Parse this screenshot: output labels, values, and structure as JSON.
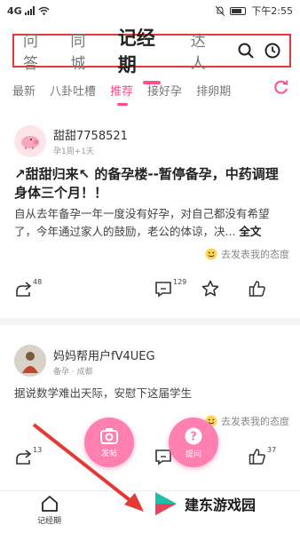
{
  "status": {
    "carrier": "4G",
    "time": "下午2:55"
  },
  "top_tabs": [
    "问答",
    "同城",
    "记经期",
    "达人"
  ],
  "sub_tabs": [
    "最新",
    "八卦吐槽",
    "推荐",
    "接好孕",
    "排卵期"
  ],
  "posts": [
    {
      "user": "甜甜7758521",
      "meta": "孕1周+1天",
      "title_line1": "↗甜甜归来↖ 的备孕楼--暂停备孕，中药调理",
      "title_line2": "身体三个月！！",
      "body_line1": "自从去年备孕一年一度没有好孕，对自己都没有希望",
      "body_line2": "了，今年通过家人的鼓励，老公的体谅，决...",
      "more": "全文",
      "attitude": "去发表我的态度",
      "shares": "48",
      "comments": "129"
    },
    {
      "user": "妈妈帮用户fV4UEG",
      "meta": "备孕 · 成都",
      "body_line1": "据说数学难出天际，安慰下这届学生",
      "attitude": "去发表我的态度",
      "shares": "13",
      "likes": "37"
    }
  ],
  "fab": {
    "post_label": "发帖",
    "ask_label": "提问"
  },
  "bottom": {
    "period_label": "记经期"
  },
  "watermark": "建东游戏园",
  "colors": {
    "accent": "#ff4f8b",
    "highlight_box": "#e53935",
    "arrow": "#e53935"
  }
}
